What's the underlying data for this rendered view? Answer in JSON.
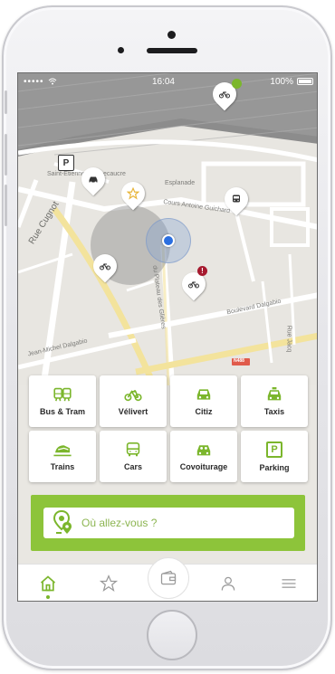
{
  "status_bar": {
    "signal": "•••••",
    "time": "16:04",
    "battery": "100%"
  },
  "map": {
    "labels": {
      "esplanade": "Esplanade",
      "antoine": "Cours Antoine Guichard",
      "cugnot": "Rue Cugnot",
      "dalgabio": "Boulevard Dalgabio",
      "plateau": "du Plateau des Glières",
      "jean_michel": "Jean-Michel Dalgabio",
      "saint": "Saint-Étienne",
      "beaucrest": "ecaucre",
      "n488": "N488",
      "rue_jacq": "Rue Jacq"
    },
    "pins": {
      "parking": "P",
      "alert": "!"
    },
    "colors": {
      "accent": "#8dc43a",
      "alert": "#a6192e",
      "location": "#2b6fe0"
    }
  },
  "transport_modes": [
    {
      "label": "Bus & Tram",
      "icon": "bus-tram-icon"
    },
    {
      "label": "Vélivert",
      "icon": "bike-icon"
    },
    {
      "label": "Citiz",
      "icon": "car-share-icon"
    },
    {
      "label": "Taxis",
      "icon": "taxi-icon"
    },
    {
      "label": "Trains",
      "icon": "train-icon"
    },
    {
      "label": "Cars",
      "icon": "coach-icon"
    },
    {
      "label": "Covoiturage",
      "icon": "carpool-icon"
    },
    {
      "label": "Parking",
      "icon": "parking-icon"
    }
  ],
  "parking_letter": "P",
  "search": {
    "placeholder": "Où allez-vous ?"
  },
  "tabs": [
    {
      "icon": "home-icon",
      "active": true
    },
    {
      "icon": "star-icon",
      "active": false
    },
    {
      "icon": "wallet-icon",
      "active": false
    },
    {
      "icon": "user-icon",
      "active": false
    },
    {
      "icon": "menu-icon",
      "active": false
    }
  ]
}
